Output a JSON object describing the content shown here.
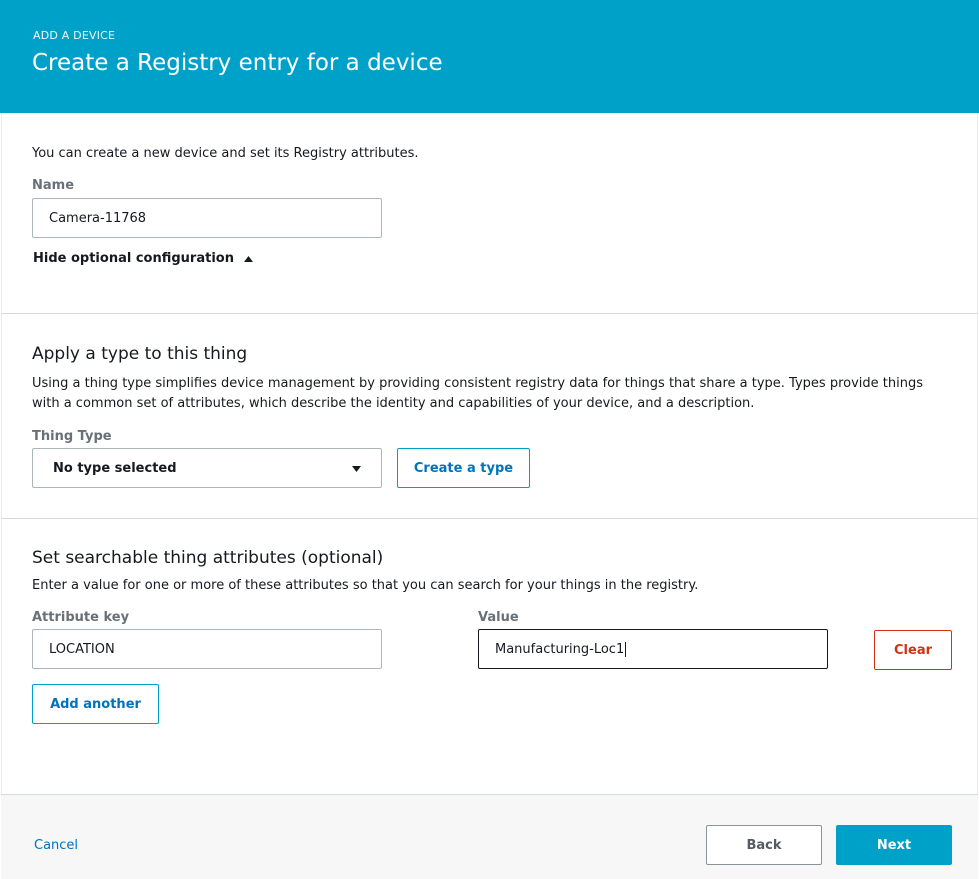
{
  "header": {
    "overline": "ADD A DEVICE",
    "title": "Create a Registry entry for a device"
  },
  "basic": {
    "intro": "You can create a new device and set its Registry attributes.",
    "name_label": "Name",
    "name_value": "Camera-11768",
    "toggle_label": "Hide optional configuration"
  },
  "type_section": {
    "heading": "Apply a type to this thing",
    "description": "Using a thing type simplifies device management by providing consistent registry data for things that share a type. Types provide things with a common set of attributes, which describe the identity and capabilities of your device, and a description.",
    "thing_type_label": "Thing Type",
    "thing_type_selected": "No type selected",
    "create_type_button": "Create a type"
  },
  "attributes_section": {
    "heading": "Set searchable thing attributes (optional)",
    "description": "Enter a value for one or more of these attributes so that you can search for your things in the registry.",
    "key_label": "Attribute key",
    "value_label": "Value",
    "rows": [
      {
        "key": "LOCATION",
        "value": "Manufacturing-Loc1"
      }
    ],
    "clear_button": "Clear",
    "add_another_button": "Add another"
  },
  "footer": {
    "cancel_label": "Cancel",
    "back_label": "Back",
    "next_label": "Next"
  },
  "colors": {
    "accent": "#00a1c9",
    "link": "#0073bb",
    "danger": "#d13212"
  }
}
